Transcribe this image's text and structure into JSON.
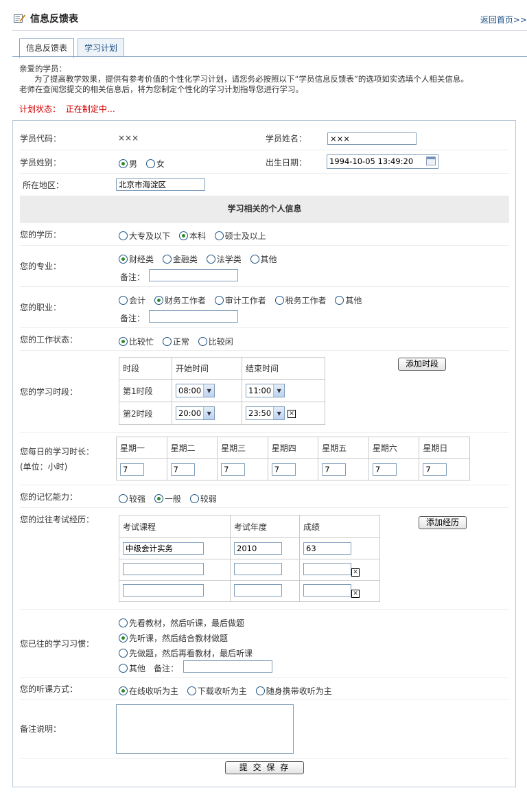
{
  "header": {
    "title": "信息反馈表",
    "home_link": "返回首页>>"
  },
  "tabs": [
    {
      "label": "信息反馈表"
    },
    {
      "label": "学习计划"
    }
  ],
  "intro": {
    "greeting": "亲爱的学员：",
    "line1": "为了提高教学效果，提供有参考价值的个性化学习计划，请您务必按照以下“学员信息反馈表”的选项如实选填个人相关信息。",
    "line2": "老师在查阅您提交的相关信息后，将为您制定个性化的学习计划指导您进行学习。"
  },
  "status": {
    "label": "计划状态：",
    "value": "正在制定中…"
  },
  "form": {
    "code_label": "学员代码：",
    "code_value": "×××",
    "name_label": "学员姓名：",
    "name_value": "×××",
    "gender_label": "学员姓别：",
    "gender_options": [
      "男",
      "女"
    ],
    "birth_label": "出生日期：",
    "birth_value": "1994-10-05 13:49:20",
    "region_label": "所在地区：",
    "region_value": "北京市海淀区",
    "section_title": "学习相关的个人信息",
    "edu_label": "您的学历：",
    "edu_options": [
      "大专及以下",
      "本科",
      "硕士及以上"
    ],
    "major_label": "您的专业：",
    "major_options": [
      "财经类",
      "金融类",
      "法学类",
      "其他"
    ],
    "remark_label": "备注：",
    "job_label": "您的职业：",
    "job_options": [
      "会计",
      "财务工作者",
      "审计工作者",
      "税务工作者",
      "其他"
    ],
    "work_label": "您的工作状态：",
    "work_options": [
      "比较忙",
      "正常",
      "比较闲"
    ],
    "period_label": "您的学习时段：",
    "period_headers": [
      "时段",
      "开始时间",
      "结束时间"
    ],
    "periods": [
      {
        "name": "第1时段",
        "start": "08:00",
        "end": "11:00"
      },
      {
        "name": "第2时段",
        "start": "20:00",
        "end": "23:50"
      }
    ],
    "add_period_button": "添加时段",
    "daily_label": "您每日的学习时长：",
    "daily_unit": "(单位：小时)",
    "weekdays": [
      "星期一",
      "星期二",
      "星期三",
      "星期四",
      "星期五",
      "星期六",
      "星期日"
    ],
    "daily_values": [
      "7",
      "7",
      "7",
      "7",
      "7",
      "7",
      "7"
    ],
    "memory_label": "您的记忆能力：",
    "memory_options": [
      "较强",
      "一般",
      "较弱"
    ],
    "exam_label": "您的过往考试经历：",
    "exam_headers": [
      "考试课程",
      "考试年度",
      "成绩"
    ],
    "exam_rows": [
      {
        "course": "中级会计实务",
        "year": "2010",
        "score": "63"
      },
      {
        "course": "",
        "year": "",
        "score": ""
      },
      {
        "course": "",
        "year": "",
        "score": ""
      }
    ],
    "add_exam_button": "添加经历",
    "habit_label": "您已往的学习习惯：",
    "habit_options": [
      "先看教材，然后听课，最后做题",
      "先听课，然后结合教材做题",
      "先做题，然后再看教材，最后听课",
      "其他"
    ],
    "habit_remark_label": "备注：",
    "listen_label": "您的听课方式：",
    "listen_options": [
      "在线收听为主",
      "下载收听为主",
      "随身携带收听为主"
    ],
    "note_label": "备注说明：",
    "submit_button": "提 交 保 存"
  }
}
